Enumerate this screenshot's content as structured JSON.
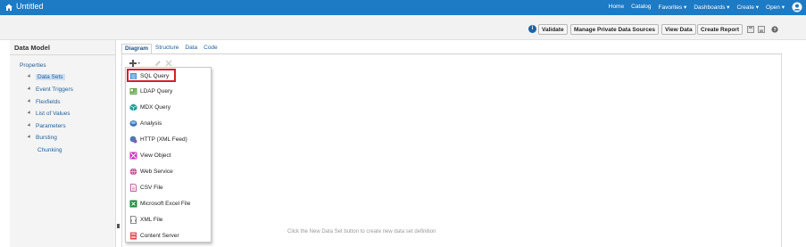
{
  "topbar": {
    "app_title": "Untitled",
    "nav": [
      "Home",
      "Catalog",
      "Favorites ▾",
      "Dashboards ▾",
      "Create ▾",
      "Open ▾"
    ]
  },
  "toolbar": {
    "validate": "Validate",
    "manage_sources": "Manage Private Data Sources",
    "view_data": "View Data",
    "create_report": "Create Report"
  },
  "data_model": {
    "title": "Data Model",
    "tree": {
      "properties": "Properties",
      "data_sets": "Data Sets",
      "event_triggers": "Event Triggers",
      "flexfields": "Flexfields",
      "list_of_values": "List of Values",
      "parameters": "Parameters",
      "bursting": "Bursting",
      "chunking": "Chunking"
    }
  },
  "tabs": [
    "Diagram",
    "Structure",
    "Data",
    "Code"
  ],
  "menu": {
    "items": [
      {
        "label": "SQL Query",
        "icon": "sql-query-icon"
      },
      {
        "label": "LDAP Query",
        "icon": "ldap-query-icon"
      },
      {
        "label": "MDX Query",
        "icon": "mdx-query-icon"
      },
      {
        "label": "Analysis",
        "icon": "analysis-icon"
      },
      {
        "label": "HTTP (XML Feed)",
        "icon": "http-feed-icon"
      },
      {
        "label": "View Object",
        "icon": "view-object-icon"
      },
      {
        "label": "Web Service",
        "icon": "web-service-icon"
      },
      {
        "label": "CSV File",
        "icon": "csv-file-icon"
      },
      {
        "label": "Microsoft Excel File",
        "icon": "excel-file-icon"
      },
      {
        "label": "XML File",
        "icon": "xml-file-icon"
      },
      {
        "label": "Content Server",
        "icon": "content-server-icon"
      }
    ]
  },
  "canvas_hint": "Click the New Data Set button to create new data set definition",
  "colors": {
    "topbar": "#1d7ac5",
    "highlight": "#d32027",
    "link": "#1f5f9b"
  }
}
